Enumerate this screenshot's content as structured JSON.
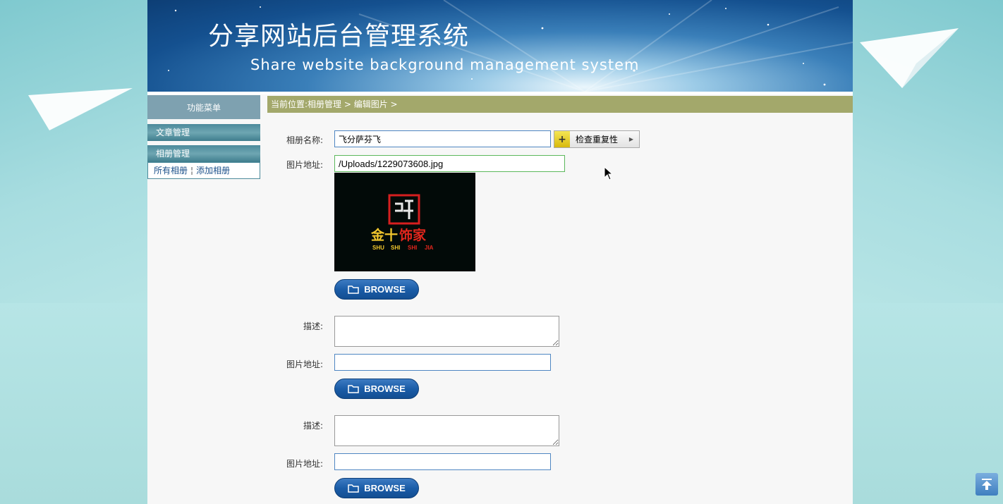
{
  "banner": {
    "title_cn": "分享网站后台管理系统",
    "title_en": "Share website background management system"
  },
  "sidebar": {
    "menu_title": "功能菜单",
    "sections": [
      {
        "label": "文章管理"
      },
      {
        "label": "相册管理"
      }
    ],
    "sub_links": [
      {
        "label": "所有相册"
      },
      {
        "label": "添加相册"
      }
    ],
    "separator": "¦"
  },
  "breadcrumb": {
    "text": "当前位置:相册管理 > 编辑图片 >"
  },
  "form": {
    "album_name_label": "相册名称:",
    "album_name_value": "飞分萨芬飞",
    "check_button_label": "检查重复性",
    "image_url_label": "图片地址:",
    "image_url_value": "/Uploads/1229073608.jpg",
    "browse_label": "BROWSE",
    "desc_label": "描述:",
    "image_url_label_2": "图片地址:",
    "image_url_value_2": "",
    "desc_label_3": "描述:",
    "image_url_label_3": "图片地址:",
    "image_url_value_3": ""
  },
  "preview_logo": {
    "cn": "金十饰家",
    "pinyin": [
      "SHU",
      "SHI",
      "SHI",
      "JIA"
    ]
  },
  "colors": {
    "breadcrumb_bg": "#a3a86b",
    "sidebar_title_bg": "#7ea1b0",
    "browse_bg": "#1b5da8",
    "input_border": "#4f86c2"
  }
}
